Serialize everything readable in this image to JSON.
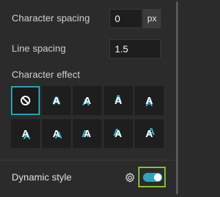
{
  "character_spacing": {
    "label": "Character spacing",
    "value": "0",
    "unit": "px"
  },
  "line_spacing": {
    "label": "Line spacing",
    "value": "1.5"
  },
  "character_effect": {
    "label": "Character effect",
    "effects": [
      {
        "name": "none",
        "glyph": ""
      },
      {
        "name": "halo-outline",
        "glyph": "A"
      },
      {
        "name": "shadow-bottom-left",
        "glyph": "A"
      },
      {
        "name": "shadow-top",
        "glyph": "A"
      },
      {
        "name": "shadow-bottom",
        "glyph": "A"
      },
      {
        "name": "shadow-bottom-right",
        "glyph": "A"
      },
      {
        "name": "shadow-right-low",
        "glyph": "A"
      },
      {
        "name": "shadow-left",
        "glyph": "A"
      },
      {
        "name": "shadow-top-left",
        "glyph": "A"
      },
      {
        "name": "shadow-top-right",
        "glyph": "A"
      }
    ],
    "selected": "none"
  },
  "dynamic_style": {
    "label": "Dynamic style",
    "enabled": true
  },
  "colors": {
    "accent": "#2fa3b8",
    "highlight": "#8bc33a",
    "background": "#2b2b2b",
    "field": "#1e1e1e"
  },
  "icons": [
    "no-effect-icon",
    "gear-icon"
  ]
}
